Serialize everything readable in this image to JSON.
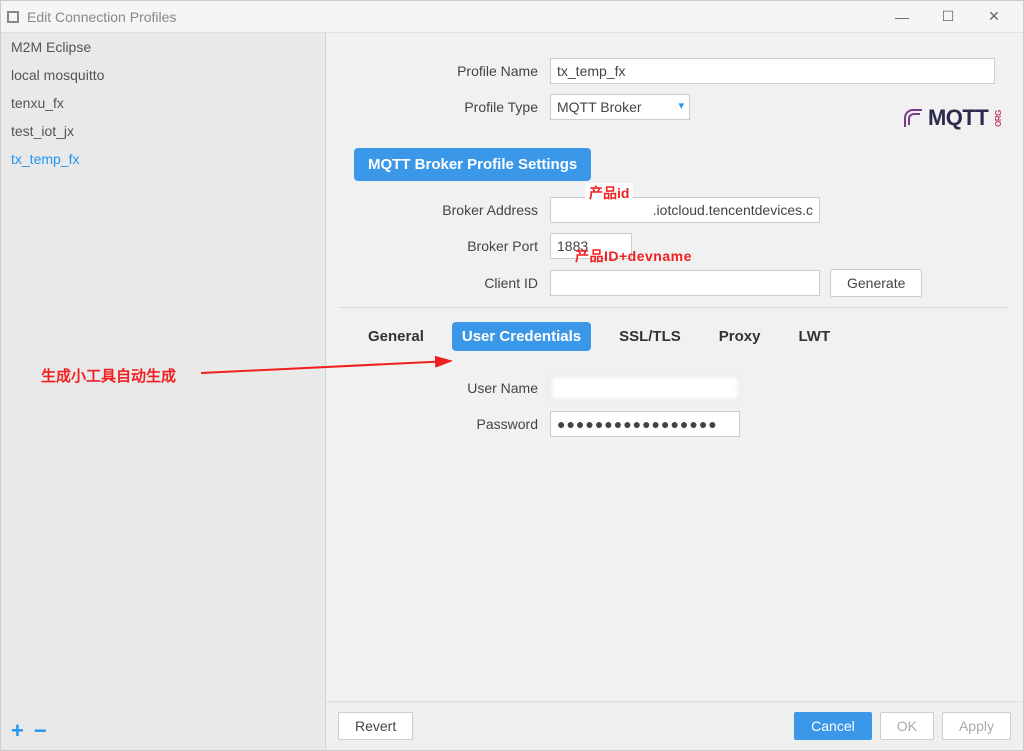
{
  "window": {
    "title": "Edit Connection Profiles"
  },
  "sidebar": {
    "profiles": [
      {
        "label": "M2M Eclipse",
        "selected": false
      },
      {
        "label": "local mosquitto",
        "selected": false
      },
      {
        "label": "tenxu_fx",
        "selected": false
      },
      {
        "label": "test_iot_jx",
        "selected": false
      },
      {
        "label": "tx_temp_fx",
        "selected": true
      }
    ]
  },
  "form": {
    "profile_name_label": "Profile Name",
    "profile_name_value": "tx_temp_fx",
    "profile_type_label": "Profile Type",
    "profile_type_value": "MQTT Broker",
    "logo_text": "MQTT",
    "logo_org": "ORG",
    "section_header": "MQTT Broker Profile Settings",
    "broker_address_label": "Broker Address",
    "broker_address_value": ".iotcloud.tencentdevices.c",
    "broker_port_label": "Broker Port",
    "broker_port_value": "1883",
    "client_id_label": "Client ID",
    "client_id_value": "",
    "generate_label": "Generate"
  },
  "tabs": {
    "general": "General",
    "user_credentials": "User Credentials",
    "ssl_tls": "SSL/TLS",
    "proxy": "Proxy",
    "lwt": "LWT"
  },
  "credentials": {
    "username_label": "User Name",
    "username_value": "",
    "password_label": "Password",
    "password_value": "●●●●●●●●●●●●●●●●●"
  },
  "annotations": {
    "product_id": "产品id",
    "client_id": "产品ID+devname",
    "auto_generate": "生成小工具自动生成"
  },
  "footer": {
    "revert": "Revert",
    "cancel": "Cancel",
    "ok": "OK",
    "apply": "Apply"
  }
}
